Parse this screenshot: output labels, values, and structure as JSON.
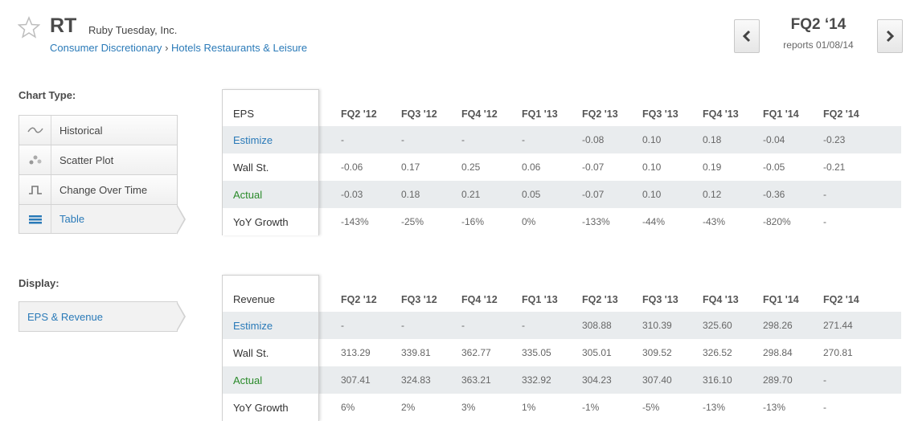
{
  "header": {
    "ticker": "RT",
    "company": "Ruby Tuesday, Inc.",
    "sector": "Consumer Discretionary",
    "separator": "›",
    "industry": "Hotels Restaurants & Leisure",
    "period": "FQ2 ‘14",
    "reports": "reports 01/08/14"
  },
  "icons": {
    "star": "star-icon",
    "prev": "chevron-left-icon",
    "next": "chevron-right-icon"
  },
  "chart_type": {
    "label": "Chart Type:",
    "items": [
      {
        "label": "Historical",
        "icon": "historical-line-icon"
      },
      {
        "label": "Scatter Plot",
        "icon": "scatter-plot-icon"
      },
      {
        "label": "Change Over Time",
        "icon": "step-chart-icon"
      },
      {
        "label": "Table",
        "icon": "table-icon",
        "active": true
      }
    ]
  },
  "display": {
    "label": "Display:",
    "selected": "EPS & Revenue"
  },
  "eps_table": {
    "title": "EPS",
    "periods": [
      "FQ2 '12",
      "FQ3 '12",
      "FQ4 '12",
      "FQ1 '13",
      "FQ2 '13",
      "FQ3 '13",
      "FQ4 '13",
      "FQ1 '14",
      "FQ2 '14"
    ],
    "rows": [
      {
        "label": "Estimize",
        "values": [
          "-",
          "-",
          "-",
          "-",
          "-0.08",
          "0.10",
          "0.18",
          "-0.04",
          "-0.23"
        ]
      },
      {
        "label": "Wall St.",
        "values": [
          "-0.06",
          "0.17",
          "0.25",
          "0.06",
          "-0.07",
          "0.10",
          "0.19",
          "-0.05",
          "-0.21"
        ]
      },
      {
        "label": "Actual",
        "values": [
          "-0.03",
          "0.18",
          "0.21",
          "0.05",
          "-0.07",
          "0.10",
          "0.12",
          "-0.36",
          "-"
        ]
      },
      {
        "label": "YoY Growth",
        "values": [
          "-143%",
          "-25%",
          "-16%",
          "0%",
          "-133%",
          "-44%",
          "-43%",
          "-820%",
          "-"
        ]
      }
    ]
  },
  "revenue_table": {
    "title": "Revenue",
    "periods": [
      "FQ2 '12",
      "FQ3 '12",
      "FQ4 '12",
      "FQ1 '13",
      "FQ2 '13",
      "FQ3 '13",
      "FQ4 '13",
      "FQ1 '14",
      "FQ2 '14"
    ],
    "rows": [
      {
        "label": "Estimize",
        "values": [
          "-",
          "-",
          "-",
          "-",
          "308.88",
          "310.39",
          "325.60",
          "298.26",
          "271.44"
        ]
      },
      {
        "label": "Wall St.",
        "values": [
          "313.29",
          "339.81",
          "362.77",
          "335.05",
          "305.01",
          "309.52",
          "326.52",
          "298.84",
          "270.81"
        ]
      },
      {
        "label": "Actual",
        "values": [
          "307.41",
          "324.83",
          "363.21",
          "332.92",
          "304.23",
          "307.40",
          "316.10",
          "289.70",
          "-"
        ]
      },
      {
        "label": "YoY Growth",
        "values": [
          "6%",
          "2%",
          "3%",
          "1%",
          "-1%",
          "-5%",
          "-13%",
          "-13%",
          "-"
        ]
      }
    ]
  },
  "colors": {
    "link": "#2a7ab8",
    "actual": "#2a8a2a",
    "row_shade": "#e9ecee"
  }
}
